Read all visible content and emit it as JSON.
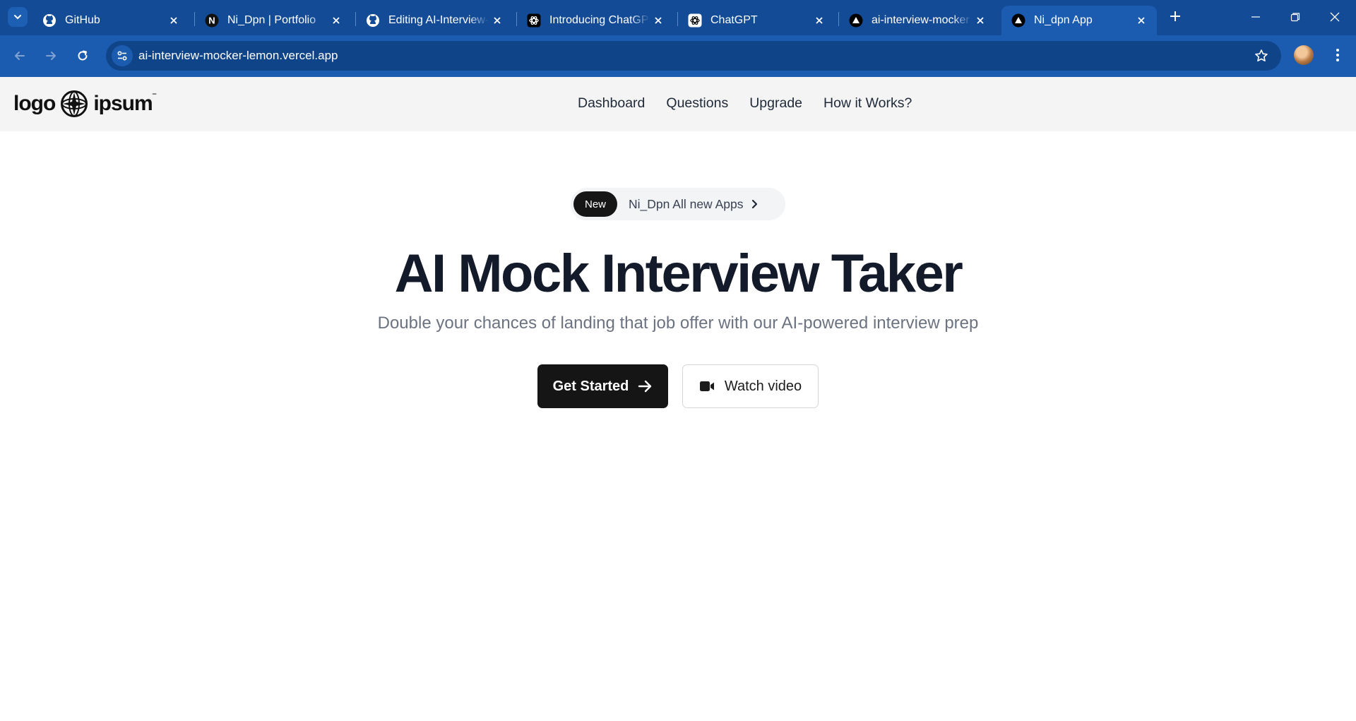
{
  "browser": {
    "tabs": [
      {
        "title": "GitHub",
        "favicon": "github-icon",
        "active": false
      },
      {
        "title": "Ni_Dpn | Portfolio",
        "favicon": "n-logo-icon",
        "active": false
      },
      {
        "title": "Editing AI-Interview-Mocker",
        "favicon": "github-icon",
        "active": false
      },
      {
        "title": "Introducing ChatGPT",
        "favicon": "openai-icon",
        "active": false
      },
      {
        "title": "ChatGPT",
        "favicon": "openai-icon",
        "active": false
      },
      {
        "title": "ai-interview-mocker",
        "favicon": "vercel-icon",
        "active": false
      },
      {
        "title": "Ni_dpn App",
        "favicon": "vercel-icon",
        "active": true
      }
    ],
    "url": "ai-interview-mocker-lemon.vercel.app",
    "colors": {
      "chrome": "#134b96",
      "toolbar": "#1b5cb0"
    }
  },
  "site": {
    "logo": {
      "left": "logo",
      "right": "ipsum"
    },
    "nav": [
      "Dashboard",
      "Questions",
      "Upgrade",
      "How it Works?"
    ]
  },
  "hero": {
    "badge": "New",
    "announcement": "Ni_Dpn All new Apps",
    "title": "AI Mock Interview Taker",
    "subtitle": "Double your chances of landing that job offer with our AI-powered interview prep",
    "primary_cta": "Get Started",
    "secondary_cta": "Watch video"
  }
}
